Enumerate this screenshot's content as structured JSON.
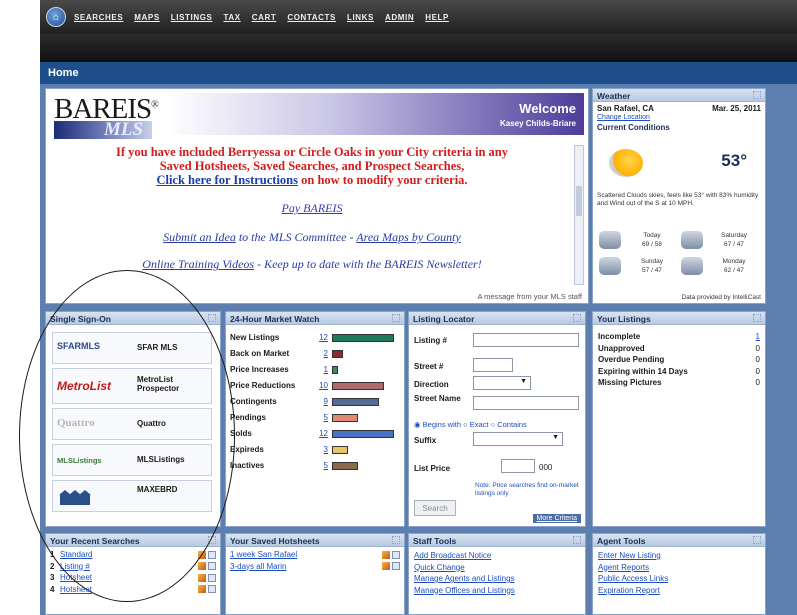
{
  "nav": {
    "home_icon": "home-icon",
    "links": [
      "SEARCHES",
      "MAPS",
      "LISTINGS",
      "TAX",
      "CART",
      "CONTACTS",
      "LINKS",
      "ADMIN",
      "HELP"
    ]
  },
  "page_title": "Home",
  "welcome": {
    "logo_text": "BAREIS",
    "logo_reg": "®",
    "logo_sub": "MLS",
    "title": "Welcome",
    "user": "Kasey Childs-Briare",
    "notice_line1": "If you have included Berryessa or Circle Oaks in your City criteria in any",
    "notice_line2": "Saved Hotsheets, Saved Searches, and Prospect Searches,",
    "instructions_link": "Click here for Instructions",
    "instructions_rest": " on how to modify your criteria.",
    "pay_link": "Pay BAREIS",
    "submit_link": "Submit an Idea",
    "submit_mid": " to the MLS Committee - ",
    "area_maps_link": "Area Maps by County",
    "online_training": "Online Training Videos",
    "newsletter_text": " - Keep up to date with the BAREIS Newsletter!",
    "footer": "A message from your MLS staff"
  },
  "weather": {
    "header": "Weather",
    "location": "San Rafael, CA",
    "date": "Mar. 25, 2011",
    "change_location": "Change Location",
    "current_conditions": "Current Conditions",
    "temperature": "53°",
    "description": "Scattered Clouds skies, feels like 53° with 83% humidity and Wind out of the S at 10 MPH.",
    "forecast": [
      {
        "day": "Today",
        "temps": "69 / 58"
      },
      {
        "day": "Saturday",
        "temps": "67 / 47"
      },
      {
        "day": "Sunday",
        "temps": "57 / 47"
      },
      {
        "day": "Monday",
        "temps": "62 / 47"
      }
    ],
    "provider": "Data provided by IntelliCast"
  },
  "signon": {
    "header": "Single Sign-On",
    "items": [
      {
        "logo": "SFARMLS",
        "label": "SFAR MLS"
      },
      {
        "logo": "MetroList",
        "label": "MetroList Prospector"
      },
      {
        "logo": "Quattro",
        "label": "Quattro"
      },
      {
        "logo": "MLSListings",
        "label": "MLSListings"
      },
      {
        "logo": "",
        "label": "MAXEBRD"
      }
    ]
  },
  "market": {
    "header": "24-Hour Market Watch",
    "rows": [
      {
        "label": "New Listings",
        "value": "12",
        "fill": 1.0,
        "color": "#1f7a57"
      },
      {
        "label": "Back on Market",
        "value": "2",
        "fill": 0.17,
        "color": "#8a2b30"
      },
      {
        "label": "Price Increases",
        "value": "1",
        "fill": 0.09,
        "color": "#3f8a5c"
      },
      {
        "label": "Price Reductions",
        "value": "10",
        "fill": 0.84,
        "color": "#b06a6e"
      },
      {
        "label": "Contingents",
        "value": "9",
        "fill": 0.75,
        "color": "#556d94"
      },
      {
        "label": "Pendings",
        "value": "5",
        "fill": 0.42,
        "color": "#e08a73"
      },
      {
        "label": "Solds",
        "value": "12",
        "fill": 1.0,
        "color": "#4a72c4"
      },
      {
        "label": "Expireds",
        "value": "3",
        "fill": 0.25,
        "color": "#e6c46a"
      },
      {
        "label": "Inactives",
        "value": "5",
        "fill": 0.42,
        "color": "#8a6a4a"
      }
    ]
  },
  "locator": {
    "header": "Listing Locator",
    "listing_label": "Listing #",
    "street_num_label": "Street #",
    "direction_label": "Direction",
    "street_name_label": "Street Name",
    "radio_begins": "Begins with",
    "radio_exact": "Exact",
    "radio_contains": "Contains",
    "suffix_label": "Suffix",
    "list_price_label": "List Price",
    "price_suffix": "000",
    "note": "Note: Price searches find on-market listings only",
    "search_button": "Search",
    "more_criteria": "More Criteria"
  },
  "your_listings": {
    "header": "Your Listings",
    "rows": [
      {
        "label": "Incomplete",
        "count": "1",
        "link": true
      },
      {
        "label": "Unapproved",
        "count": "0",
        "link": false
      },
      {
        "label": "Overdue Pending",
        "count": "0",
        "link": false
      },
      {
        "label": "Expiring within 14 Days",
        "count": "0",
        "link": false
      },
      {
        "label": "Missing Pictures",
        "count": "0",
        "link": false
      }
    ]
  },
  "recent_searches": {
    "header": "Your Recent Searches",
    "rows": [
      {
        "n": "1",
        "label": "Standard"
      },
      {
        "n": "2",
        "label": "Listing #"
      },
      {
        "n": "3",
        "label": "Hotsheet"
      },
      {
        "n": "4",
        "label": "Hotsheet"
      }
    ]
  },
  "saved_hotsheets": {
    "header": "Your Saved Hotsheets",
    "rows": [
      {
        "label": "1 week San Rafael"
      },
      {
        "label": "3-days all Marin"
      }
    ]
  },
  "staff_tools": {
    "header": "Staff Tools",
    "links": [
      "Add Broadcast Notice",
      "Quick Change",
      "Manage Agents and Listings",
      "Manage Offices and Listings"
    ]
  },
  "agent_tools": {
    "header": "Agent Tools",
    "links": [
      "Enter New Listing",
      "Agent Reports",
      "Public Access Links",
      "Expiration Report"
    ]
  }
}
